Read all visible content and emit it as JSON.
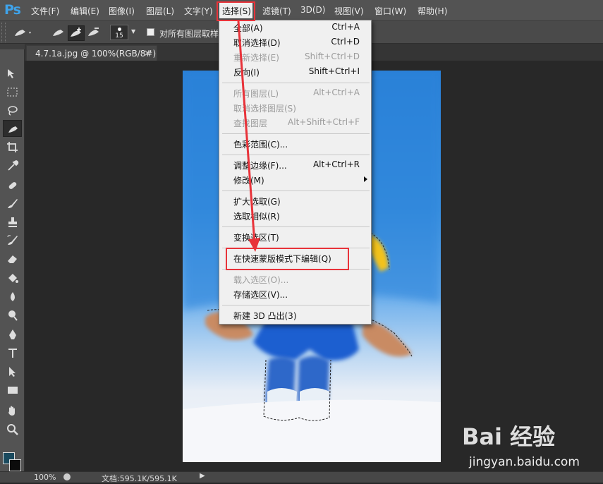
{
  "app": {
    "logo": "Ps"
  },
  "menubar": {
    "items": [
      {
        "label": "文件(F)"
      },
      {
        "label": "编辑(E)"
      },
      {
        "label": "图像(I)"
      },
      {
        "label": "图层(L)"
      },
      {
        "label": "文字(Y)"
      },
      {
        "label": "选择(S)"
      },
      {
        "label": "滤镜(T)"
      },
      {
        "label": "3D(D)"
      },
      {
        "label": "视图(V)"
      },
      {
        "label": "窗口(W)"
      },
      {
        "label": "帮助(H)"
      }
    ],
    "active_index": 5
  },
  "options": {
    "brush_size": "15",
    "sample_all_layers_label": "对所有图层取样",
    "sample_all_layers_checked": false
  },
  "document": {
    "tab_label": "4.7.1a.jpg @ 100%(RGB/8#)",
    "close_glyph": "×"
  },
  "status": {
    "zoom": "100%",
    "doc_info": "文档:595.1K/595.1K",
    "arrow_glyph": "▶"
  },
  "select_menu": {
    "groups": [
      [
        {
          "label": "全部(A)",
          "shortcut": "Ctrl+A",
          "enabled": true
        },
        {
          "label": "取消选择(D)",
          "shortcut": "Ctrl+D",
          "enabled": true
        },
        {
          "label": "重新选择(E)",
          "shortcut": "Shift+Ctrl+D",
          "enabled": false
        },
        {
          "label": "反向(I)",
          "shortcut": "Shift+Ctrl+I",
          "enabled": true
        }
      ],
      [
        {
          "label": "所有图层(L)",
          "shortcut": "Alt+Ctrl+A",
          "enabled": false
        },
        {
          "label": "取消选择图层(S)",
          "shortcut": "",
          "enabled": false
        },
        {
          "label": "查找图层",
          "shortcut": "Alt+Shift+Ctrl+F",
          "enabled": false
        }
      ],
      [
        {
          "label": "色彩范围(C)...",
          "shortcut": "",
          "enabled": true
        }
      ],
      [
        {
          "label": "调整边缘(F)...",
          "shortcut": "Alt+Ctrl+R",
          "enabled": true
        },
        {
          "label": "修改(M)",
          "shortcut": "",
          "enabled": true,
          "submenu": true
        }
      ],
      [
        {
          "label": "扩大选取(G)",
          "shortcut": "",
          "enabled": true
        },
        {
          "label": "选取相似(R)",
          "shortcut": "",
          "enabled": true
        }
      ],
      [
        {
          "label": "变换选区(T)",
          "shortcut": "",
          "enabled": true
        }
      ],
      [
        {
          "label": "在快速蒙版模式下编辑(Q)",
          "shortcut": "",
          "enabled": true,
          "highlighted": true
        }
      ],
      [
        {
          "label": "载入选区(O)...",
          "shortcut": "",
          "enabled": false
        },
        {
          "label": "存储选区(V)...",
          "shortcut": "",
          "enabled": true
        }
      ],
      [
        {
          "label": "新建 3D 凸出(3)",
          "shortcut": "",
          "enabled": true
        }
      ]
    ]
  },
  "watermark": {
    "brand": "Bai 经验",
    "url": "jingyan.baidu.com"
  },
  "colors": {
    "annotation_red": "#e8333a",
    "foreground_swatch": "#1a4a5e",
    "background_swatch": "#0c0c0c"
  },
  "tools": [
    "move-tool-icon",
    "marquee-tool-icon",
    "lasso-tool-icon",
    "quick-select-tool-icon",
    "crop-tool-icon",
    "eyedropper-tool-icon",
    "healing-brush-icon",
    "brush-tool-icon",
    "clone-stamp-icon",
    "history-brush-icon",
    "eraser-tool-icon",
    "paint-bucket-icon",
    "blur-tool-icon",
    "dodge-tool-icon",
    "pen-tool-icon",
    "type-tool-icon",
    "path-select-icon",
    "rectangle-tool-icon",
    "hand-tool-icon",
    "zoom-tool-icon"
  ]
}
